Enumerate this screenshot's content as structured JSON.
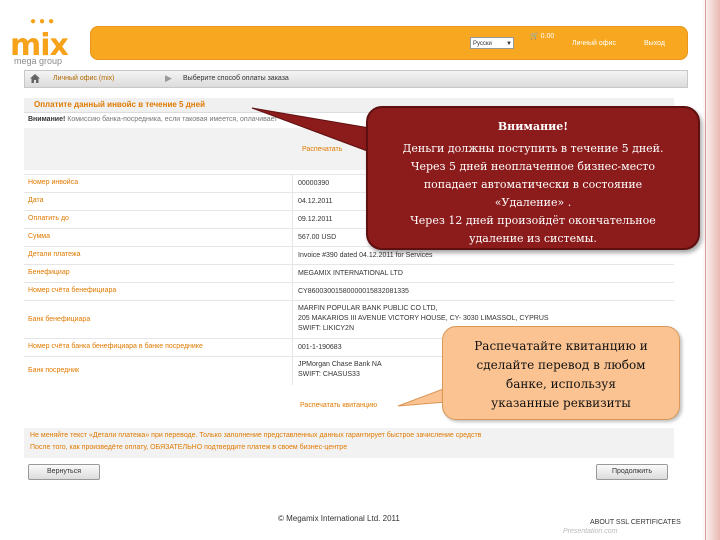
{
  "header": {
    "logo_text": "mix",
    "logo_sub": "mega group",
    "language": "Русски",
    "cart": "0.00",
    "office_link": "Личный офис",
    "logout_link": "Выход"
  },
  "breadcrumb": {
    "item1": "Личный офис (mix)",
    "item2": "Выберите способ оплаты заказа"
  },
  "panel": {
    "title": "Оплатите данный инвойс в течение 5 дней",
    "warning_bold": "Внимание!",
    "warning_text": " Комиссию банка-посредника, если таковая имеется, оплачивает",
    "print_top": "Распечатать",
    "print_bottom": "Распечатать квитанцию",
    "notice_line1": "Не меняйте текст «Детали платежа» при переводе. Только заполнение представленных данных гарантирует быстрое зачисление средств",
    "notice_line2": "После того, как произведёте оплату, ОБЯЗАТЕЛЬНО подтвердите платеж в своем бизнес-центре",
    "back_button": "Вернуться",
    "continue_button": "Продолжить"
  },
  "rows": [
    {
      "label": "Номер инвойса",
      "value": "00000390"
    },
    {
      "label": "Дата",
      "value": "04.12.2011"
    },
    {
      "label": "Оплатить до",
      "value": "09.12.2011"
    },
    {
      "label": "Сумма",
      "value": "567.00 USD"
    },
    {
      "label": "Детали платежа",
      "value": "Invoice #390 dated 04.12.2011 for Services"
    },
    {
      "label": "Бенефициар",
      "value": "MEGAMIX INTERNATIONAL LTD"
    },
    {
      "label": "Номер счёта бенефициара",
      "value": "CY86003001580000015832081335"
    },
    {
      "label": "Банк бенефициара",
      "value": "MARFIN POPULAR BANK PUBLIC CO LTD,",
      "value2": "205 MAKARIOS III AVENUE VICTORY HOUSE, CY- 3030 LIMASSOL, CYPRUS",
      "value3": "SWIFT: LIKICY2N"
    },
    {
      "label": "Номер счёта банка бенефициара в банке посреднике",
      "value": "001-1-190683"
    },
    {
      "label": "Банк посредник",
      "value": "JPMorgan Chase Bank NA",
      "value2": "SWIFT: CHASUS33"
    }
  ],
  "footer": {
    "copyright": "© Megamix International Ltd. 2011",
    "ssl": "ABOUT SSL CERTIFICATES",
    "brand": "Presentation.com"
  },
  "callout_red": {
    "title": "Внимание!",
    "line1": "Деньги должны поступить в течение 5 дней.",
    "line2": "Через 5 дней неоплаченное бизнес-место",
    "line3": "попадает автоматически в состояние",
    "line4": "«Удаление» .",
    "line5": "Через 12 дней произойдёт окончательное",
    "line6": "удаление из системы."
  },
  "callout_orange": {
    "line1": "Распечатайте квитанцию и",
    "line2": "сделайте перевод в любом",
    "line3": "банке, используя",
    "line4": "указанные реквизиты"
  },
  "colors": {
    "accent": "#f7a820",
    "label": "#e07a00",
    "callout_red": "#8c1c1c",
    "callout_orange": "#fbc392"
  }
}
